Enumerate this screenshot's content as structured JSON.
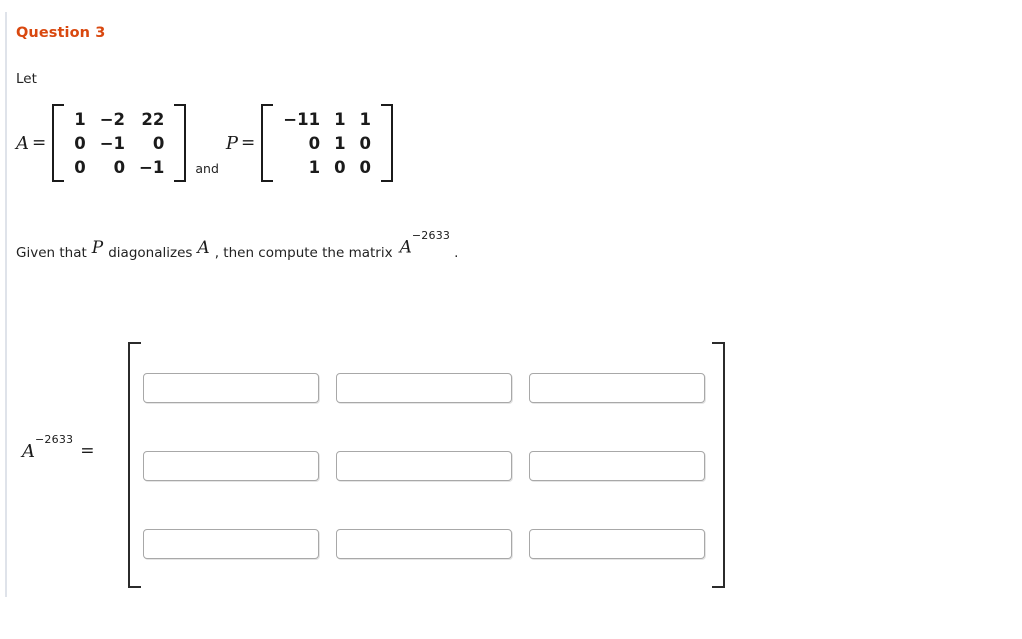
{
  "question": {
    "title": "Question 3",
    "intro": "Let"
  },
  "matrices": {
    "A": {
      "label": "A",
      "equals": "=",
      "rows": [
        [
          "1",
          "−2",
          "22"
        ],
        [
          "0",
          "−1",
          "0"
        ],
        [
          "0",
          "0",
          "−1"
        ]
      ]
    },
    "conjunction": "and",
    "P": {
      "label": "P",
      "equals": "=",
      "rows": [
        [
          "−11",
          "1",
          "1"
        ],
        [
          "0",
          "1",
          "0"
        ],
        [
          "1",
          "0",
          "0"
        ]
      ]
    }
  },
  "sentence": {
    "part1": "Given that",
    "var1": "P",
    "part2": "diagonalizes",
    "var2": "A",
    "part3": ", then compute the matrix",
    "power_base": "A",
    "power_exponent": "−2633",
    "period": "."
  },
  "answer": {
    "label_base": "A",
    "label_exponent": "−2633",
    "equals": "=",
    "cells": [
      [
        "",
        "",
        ""
      ],
      [
        "",
        "",
        ""
      ],
      [
        "",
        "",
        ""
      ]
    ],
    "placeholder": ""
  },
  "colors": {
    "heading": "#d9480f",
    "body_text": "#222222",
    "rule": "#dfe3ea",
    "input_border": "#a8a8a8",
    "bracket": "#2b2b2b"
  }
}
